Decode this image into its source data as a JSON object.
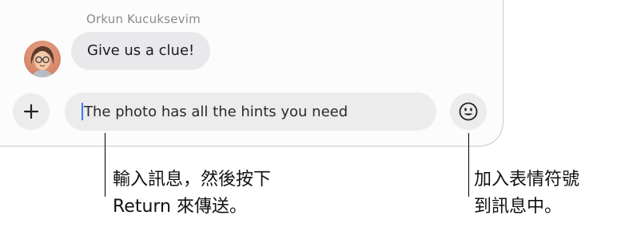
{
  "conversation": {
    "sender_name": "Orkun Kucuksevim",
    "message": "Give us a clue!"
  },
  "composer": {
    "plus_label": "+",
    "input_value": "The photo has all the hints you need"
  },
  "callouts": {
    "input_line1": "輸入訊息，然後按下",
    "input_line2": "Return 來傳送。",
    "emoji_line1": "加入表情符號",
    "emoji_line2": "到訊息中。"
  }
}
